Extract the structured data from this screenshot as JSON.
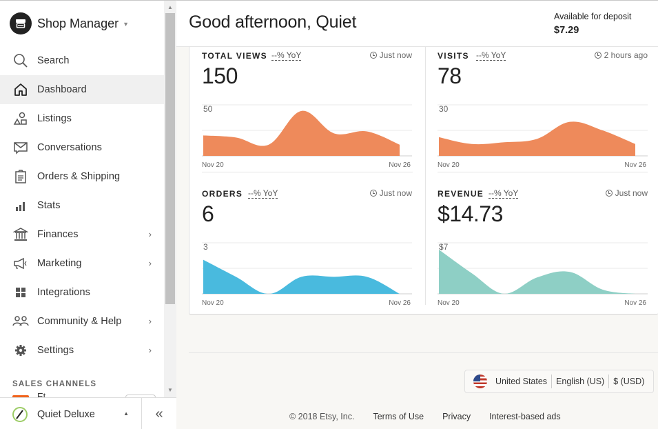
{
  "sidebar": {
    "brand": {
      "title": "Shop Manager"
    },
    "items": [
      {
        "label": "Search",
        "icon": "search-icon",
        "active": false,
        "has_submenu": false
      },
      {
        "label": "Dashboard",
        "icon": "home-icon",
        "active": true,
        "has_submenu": false
      },
      {
        "label": "Listings",
        "icon": "shapes-icon",
        "active": false,
        "has_submenu": false
      },
      {
        "label": "Conversations",
        "icon": "message-icon",
        "active": false,
        "has_submenu": false
      },
      {
        "label": "Orders & Shipping",
        "icon": "clipboard-icon",
        "active": false,
        "has_submenu": false
      },
      {
        "label": "Stats",
        "icon": "bar-chart-icon",
        "active": false,
        "has_submenu": false
      },
      {
        "label": "Finances",
        "icon": "bank-icon",
        "active": false,
        "has_submenu": true
      },
      {
        "label": "Marketing",
        "icon": "megaphone-icon",
        "active": false,
        "has_submenu": true
      },
      {
        "label": "Integrations",
        "icon": "grid-icon",
        "active": false,
        "has_submenu": false
      },
      {
        "label": "Community & Help",
        "icon": "people-icon",
        "active": false,
        "has_submenu": true
      },
      {
        "label": "Settings",
        "icon": "gear-icon",
        "active": false,
        "has_submenu": true
      }
    ],
    "sales_channels_label": "SALES CHANNELS",
    "channel_partial": "Et",
    "shop_name": "Quiet Deluxe",
    "collapse_glyph": "«"
  },
  "header": {
    "greeting": "Good afternoon, Quiet",
    "deposit_label": "Available for deposit",
    "deposit_value": "$7.29"
  },
  "metrics": [
    {
      "title": "TOTAL VIEWS",
      "yoy": "--% YoY",
      "updated": "Just now",
      "value": "150"
    },
    {
      "title": "VISITS",
      "yoy": "--% YoY",
      "updated": "2 hours ago",
      "value": "78"
    },
    {
      "title": "ORDERS",
      "yoy": "--% YoY",
      "updated": "Just now",
      "value": "6"
    },
    {
      "title": "REVENUE",
      "yoy": "--% YoY",
      "updated": "Just now",
      "value": "$14.73"
    }
  ],
  "colors": {
    "views": "#ee8a5b",
    "visits": "#ee8a5b",
    "orders": "#49bade",
    "revenue": "#8ecfc5"
  },
  "chart_data": [
    {
      "type": "area",
      "title": "TOTAL VIEWS",
      "x": [
        "Nov 20",
        "Nov 21",
        "Nov 22",
        "Nov 23",
        "Nov 24",
        "Nov 25",
        "Nov 26"
      ],
      "x_tick_labels": [
        "Nov 20",
        "Nov 26"
      ],
      "values": [
        20,
        18,
        11,
        44,
        22,
        24,
        11
      ],
      "y_tick_label": "50",
      "ylim": [
        0,
        50
      ],
      "grid": true
    },
    {
      "type": "area",
      "title": "VISITS",
      "x": [
        "Nov 20",
        "Nov 21",
        "Nov 22",
        "Nov 23",
        "Nov 24",
        "Nov 25",
        "Nov 26"
      ],
      "x_tick_labels": [
        "Nov 20",
        "Nov 26"
      ],
      "values": [
        11,
        7,
        8,
        10,
        20,
        15,
        7
      ],
      "y_tick_label": "30",
      "ylim": [
        0,
        30
      ],
      "grid": true
    },
    {
      "type": "area",
      "title": "ORDERS",
      "x": [
        "Nov 20",
        "Nov 21",
        "Nov 22",
        "Nov 23",
        "Nov 24",
        "Nov 25",
        "Nov 26"
      ],
      "x_tick_labels": [
        "Nov 20",
        "Nov 26"
      ],
      "values": [
        2,
        1,
        0,
        1,
        1,
        1,
        0
      ],
      "y_tick_label": "3",
      "ylim": [
        0,
        3
      ],
      "grid": true
    },
    {
      "type": "area",
      "title": "REVENUE",
      "x": [
        "Nov 20",
        "Nov 21",
        "Nov 22",
        "Nov 23",
        "Nov 24",
        "Nov 25",
        "Nov 26"
      ],
      "x_tick_labels": [
        "Nov 20",
        "Nov 26"
      ],
      "values": [
        6.06,
        2.84,
        0,
        2.25,
        3.0,
        0.58,
        0
      ],
      "y_tick_label": "$7",
      "ylim": [
        0,
        7
      ],
      "grid": true
    }
  ],
  "footer": {
    "locale": {
      "country": "United States",
      "language": "English (US)",
      "currency": "$ (USD)"
    },
    "copyright": "© 2018 Etsy, Inc.",
    "links": [
      "Terms of Use",
      "Privacy",
      "Interest-based ads"
    ]
  }
}
